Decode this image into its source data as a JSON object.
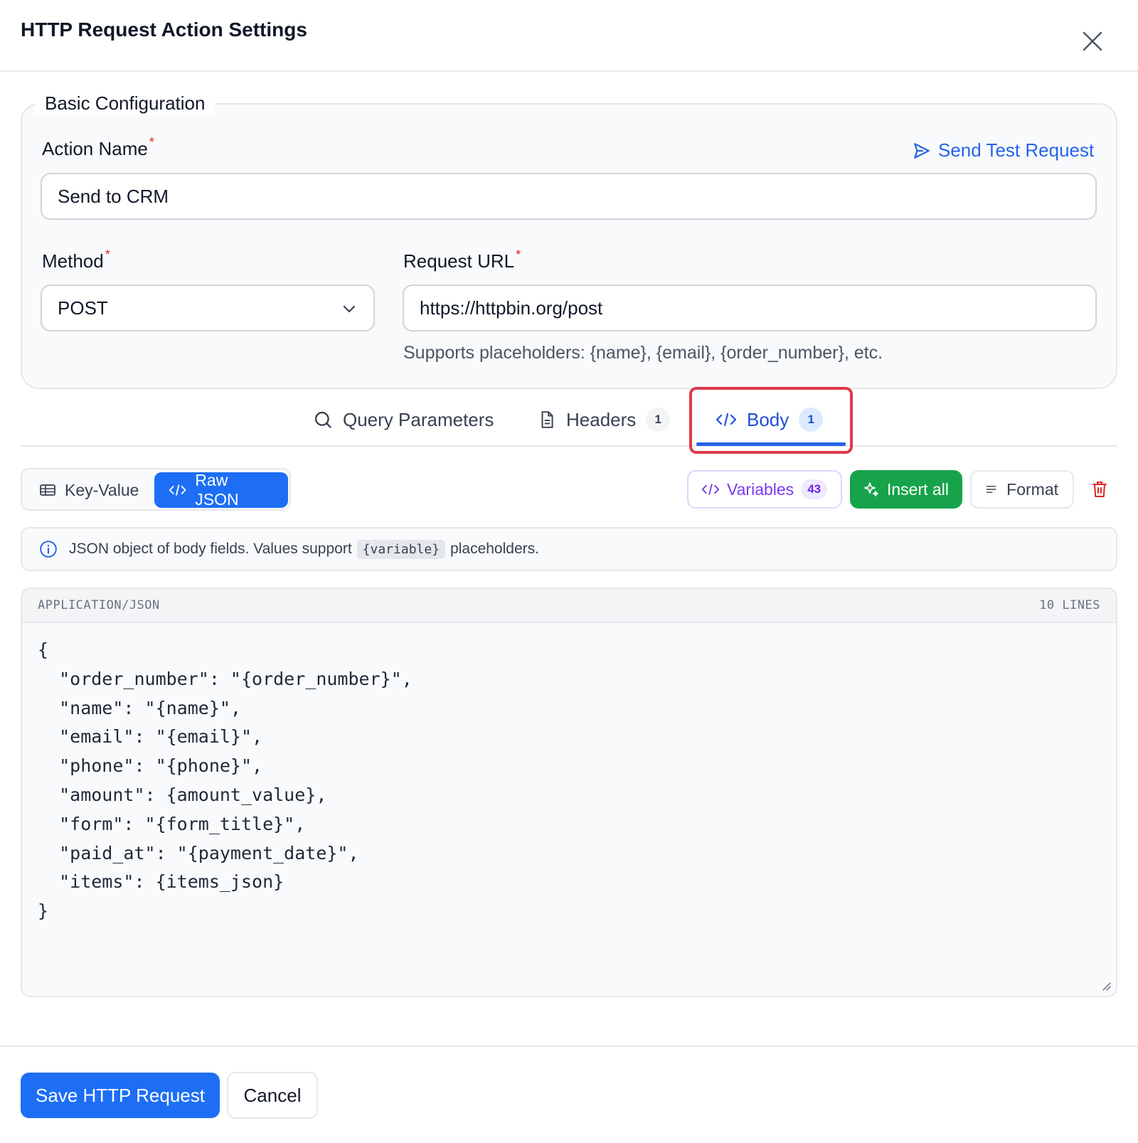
{
  "dialog": {
    "title": "HTTP Request Action Settings"
  },
  "basic": {
    "legend": "Basic Configuration",
    "action_name": {
      "label": "Action Name",
      "required": "*",
      "value": "Send to CRM"
    },
    "send_test": {
      "label": "Send Test Request"
    },
    "method": {
      "label": "Method",
      "required": "*",
      "value": "POST"
    },
    "url": {
      "label": "Request URL",
      "required": "*",
      "value": "https://httpbin.org/post",
      "hint": "Supports placeholders: {name}, {email}, {order_number}, etc."
    }
  },
  "tabs": [
    {
      "label": "Query Parameters",
      "icon": "search-icon",
      "badge": null,
      "active": false
    },
    {
      "label": "Headers",
      "icon": "document-icon",
      "badge": "1",
      "active": false
    },
    {
      "label": "Body",
      "icon": "code-icon",
      "badge": "1",
      "active": true
    }
  ],
  "body_toolbar": {
    "mode_key_value": "Key-Value",
    "mode_raw_json": "Raw JSON",
    "variables_label": "Variables",
    "variables_count": "43",
    "insert_all": "Insert all",
    "format": "Format"
  },
  "info": {
    "before": "JSON object of body fields. Values support",
    "code": "{variable}",
    "after": "placeholders."
  },
  "editor": {
    "content_type": "APPLICATION/JSON",
    "line_count": "10 LINES",
    "code": "{\n  \"order_number\": \"{order_number}\",\n  \"name\": \"{name}\",\n  \"email\": \"{email}\",\n  \"phone\": \"{phone}\",\n  \"amount\": {amount_value},\n  \"form\": \"{form_title}\",\n  \"paid_at\": \"{payment_date}\",\n  \"items\": {items_json}\n}"
  },
  "footer": {
    "save": "Save HTTP Request",
    "cancel": "Cancel"
  },
  "colors": {
    "primary": "#1d6ef5",
    "link": "#2563eb",
    "success": "#16a34a",
    "violet": "#7c3aed",
    "danger": "#dc2626",
    "highlight": "#dc3b4b"
  }
}
